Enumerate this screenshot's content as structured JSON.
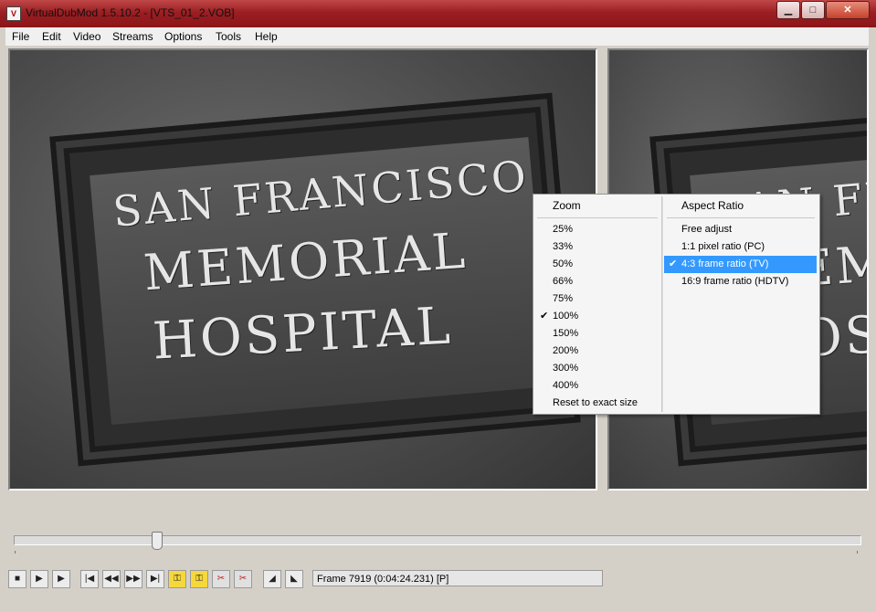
{
  "window": {
    "title": "VirtualDubMod 1.5.10.2 - [VTS_01_2.VOB]",
    "min_glyph": "▁",
    "max_glyph": "□",
    "close_glyph": "✕"
  },
  "menubar": {
    "items": [
      "File",
      "Edit",
      "Video",
      "Streams",
      "Options",
      "Tools",
      "Help"
    ]
  },
  "video": {
    "sign_lines": [
      "SAN FRANCISCO",
      "MEMORIAL",
      "HOSPITAL"
    ]
  },
  "context_menu": {
    "zoom_header": "Zoom",
    "zoom_items": [
      "25%",
      "33%",
      "50%",
      "66%",
      "75%",
      "100%",
      "150%",
      "200%",
      "300%",
      "400%",
      "Reset to exact size"
    ],
    "zoom_checked": "100%",
    "aspect_header": "Aspect Ratio",
    "aspect_items": [
      "Free adjust",
      "1:1 pixel ratio (PC)",
      "4:3 frame ratio (TV)",
      "16:9 frame ratio (HDTV)"
    ],
    "aspect_checked": "4:3 frame ratio (TV)",
    "check_glyph": "✔"
  },
  "seekbar": {
    "position_fraction": 0.168
  },
  "toolbar": {
    "buttons": [
      {
        "name": "stop-button",
        "icon": "■",
        "style": "n"
      },
      {
        "name": "play-input-button",
        "icon": "▶",
        "style": "n"
      },
      {
        "name": "play-output-button",
        "icon": "▶",
        "style": "n"
      },
      {
        "name": "go-start-button",
        "icon": "|◀",
        "style": "n"
      },
      {
        "name": "prev-frame-button",
        "icon": "◀◀",
        "style": "n"
      },
      {
        "name": "next-frame-button",
        "icon": "▶▶",
        "style": "n"
      },
      {
        "name": "go-end-button",
        "icon": "▶|",
        "style": "n"
      },
      {
        "name": "prev-keyframe-button",
        "icon": "⚿",
        "style": "y"
      },
      {
        "name": "next-keyframe-button",
        "icon": "⚿",
        "style": "y"
      },
      {
        "name": "scene-back-button",
        "icon": "✂",
        "style": "g"
      },
      {
        "name": "scene-forward-button",
        "icon": "✂",
        "style": "g"
      },
      {
        "name": "mark-in-button",
        "icon": "◢",
        "style": "n"
      },
      {
        "name": "mark-out-button",
        "icon": "◣",
        "style": "n"
      }
    ],
    "frame_status": "Frame 7919 (0:04:24.231) [P]"
  }
}
